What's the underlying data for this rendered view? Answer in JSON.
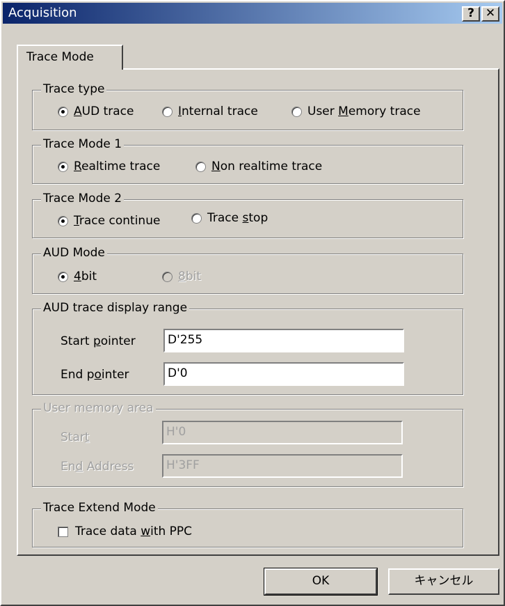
{
  "window": {
    "title": "Acquisition",
    "help_button": "?",
    "close_button": "✕"
  },
  "tab": {
    "label": "Trace Mode"
  },
  "trace_type": {
    "legend": "Trace type",
    "options": [
      {
        "pre": "",
        "u": "A",
        "post": "UD trace",
        "checked": true
      },
      {
        "pre": "",
        "u": "I",
        "post": "nternal trace",
        "checked": false
      },
      {
        "pre": "User ",
        "u": "M",
        "post": "emory trace",
        "checked": false
      }
    ]
  },
  "trace_mode1": {
    "legend": "Trace Mode 1",
    "options": [
      {
        "pre": "",
        "u": "R",
        "post": "ealtime trace",
        "checked": true
      },
      {
        "pre": "",
        "u": "N",
        "post": "on realtime trace",
        "checked": false
      }
    ]
  },
  "trace_mode2": {
    "legend": "Trace Mode 2",
    "options": [
      {
        "pre": "",
        "u": "T",
        "post": "race continue",
        "checked": true
      },
      {
        "pre": "Trace ",
        "u": "s",
        "post": "top",
        "checked": false
      }
    ]
  },
  "aud_mode": {
    "legend": "AUD Mode",
    "options": [
      {
        "pre": "",
        "u": "4",
        "post": "bit",
        "checked": true
      },
      {
        "pre": "",
        "u": "8",
        "post": "bit",
        "checked": false,
        "disabled": true
      }
    ]
  },
  "aud_range": {
    "legend": "AUD trace display range",
    "start_label_pre": "Start ",
    "start_label_u": "p",
    "start_label_post": "ointer",
    "start_value": "D'255",
    "end_label_pre": "End p",
    "end_label_u": "o",
    "end_label_post": "inter",
    "end_value": "D'0"
  },
  "user_memory": {
    "legend": "User memory area",
    "start_label_pre": "Star",
    "start_label_u": "t",
    "start_label_post": "",
    "start_value": "H'0",
    "end_label_pre": "En",
    "end_label_u": "d",
    "end_label_post": " Address",
    "end_value": "H'3FF"
  },
  "extend_mode": {
    "legend": "Trace Extend Mode",
    "checkbox_pre": "Trace data ",
    "checkbox_u": "w",
    "checkbox_post": "ith PPC",
    "checked": false
  },
  "buttons": {
    "ok": "OK",
    "cancel": "キャンセル"
  }
}
